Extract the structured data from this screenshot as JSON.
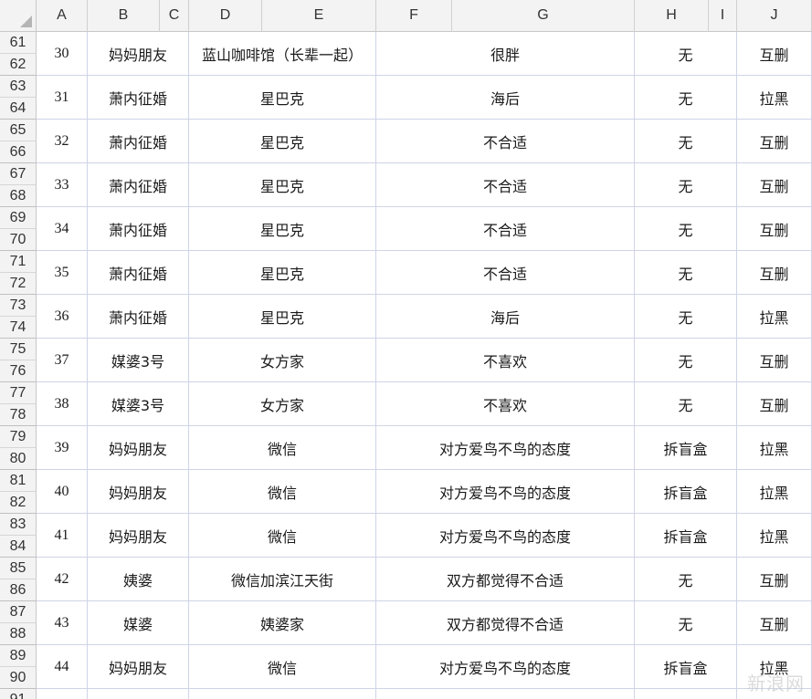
{
  "columns": [
    "A",
    "B",
    "C",
    "D",
    "E",
    "F",
    "G",
    "H",
    "I",
    "J"
  ],
  "row_numbers": [
    61,
    62,
    63,
    64,
    65,
    66,
    67,
    68,
    69,
    70,
    71,
    72,
    73,
    74,
    75,
    76,
    77,
    78,
    79,
    80,
    81,
    82,
    83,
    84,
    85,
    86,
    87,
    88,
    89,
    90,
    91
  ],
  "rows": [
    {
      "no": "30",
      "source": "妈妈朋友",
      "place": "蓝山咖啡馆（长辈一起）",
      "impression": "很胖",
      "cost": "无",
      "result": "互删"
    },
    {
      "no": "31",
      "source": "萧内征婚",
      "place": "星巴克",
      "impression": "海后",
      "cost": "无",
      "result": "拉黑"
    },
    {
      "no": "32",
      "source": "萧内征婚",
      "place": "星巴克",
      "impression": "不合适",
      "cost": "无",
      "result": "互删"
    },
    {
      "no": "33",
      "source": "萧内征婚",
      "place": "星巴克",
      "impression": "不合适",
      "cost": "无",
      "result": "互删"
    },
    {
      "no": "34",
      "source": "萧内征婚",
      "place": "星巴克",
      "impression": "不合适",
      "cost": "无",
      "result": "互删"
    },
    {
      "no": "35",
      "source": "萧内征婚",
      "place": "星巴克",
      "impression": "不合适",
      "cost": "无",
      "result": "互删"
    },
    {
      "no": "36",
      "source": "萧内征婚",
      "place": "星巴克",
      "impression": "海后",
      "cost": "无",
      "result": "拉黑"
    },
    {
      "no": "37",
      "source": "媒婆3号",
      "place": "女方家",
      "impression": "不喜欢",
      "cost": "无",
      "result": "互删"
    },
    {
      "no": "38",
      "source": "媒婆3号",
      "place": "女方家",
      "impression": "不喜欢",
      "cost": "无",
      "result": "互删"
    },
    {
      "no": "39",
      "source": "妈妈朋友",
      "place": "微信",
      "impression": "对方爱鸟不鸟的态度",
      "cost": "拆盲盒",
      "result": "拉黑"
    },
    {
      "no": "40",
      "source": "妈妈朋友",
      "place": "微信",
      "impression": "对方爱鸟不鸟的态度",
      "cost": "拆盲盒",
      "result": "拉黑"
    },
    {
      "no": "41",
      "source": "妈妈朋友",
      "place": "微信",
      "impression": "对方爱鸟不鸟的态度",
      "cost": "拆盲盒",
      "result": "拉黑"
    },
    {
      "no": "42",
      "source": "姨婆",
      "place": "微信加滨江天街",
      "impression": "双方都觉得不合适",
      "cost": "无",
      "result": "互删"
    },
    {
      "no": "43",
      "source": "媒婆",
      "place": "姨婆家",
      "impression": "双方都觉得不合适",
      "cost": "无",
      "result": "互删"
    },
    {
      "no": "44",
      "source": "妈妈朋友",
      "place": "微信",
      "impression": "对方爱鸟不鸟的态度",
      "cost": "拆盲盒",
      "result": "拉黑"
    }
  ],
  "watermark": "新浪网"
}
